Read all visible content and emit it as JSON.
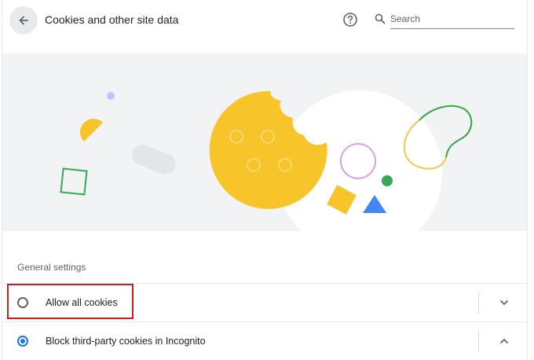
{
  "header": {
    "title": "Cookies and other site data",
    "back_icon": "arrow-back-icon",
    "help_icon": "help-icon",
    "search": {
      "placeholder": "Search",
      "value": "",
      "icon": "search-icon"
    }
  },
  "illustration": {
    "colors": {
      "background": "#f1f3f4",
      "cookie": "#f7c42a",
      "green": "#34a853",
      "blue": "#4285f4",
      "pink": "#d9a2e0",
      "grey_pill": "#e3e5e8",
      "light_blue_dot": "#aecbfa"
    }
  },
  "general_settings": {
    "title": "General settings",
    "options": [
      {
        "label": "Allow all cookies",
        "checked": false,
        "expand_icon": "chevron-down-icon"
      },
      {
        "label": "Block third-party cookies in Incognito",
        "checked": true,
        "expand_icon": "chevron-up-icon"
      }
    ]
  },
  "colors": {
    "accent": "#1a73e8",
    "highlight": "#c5221f"
  }
}
